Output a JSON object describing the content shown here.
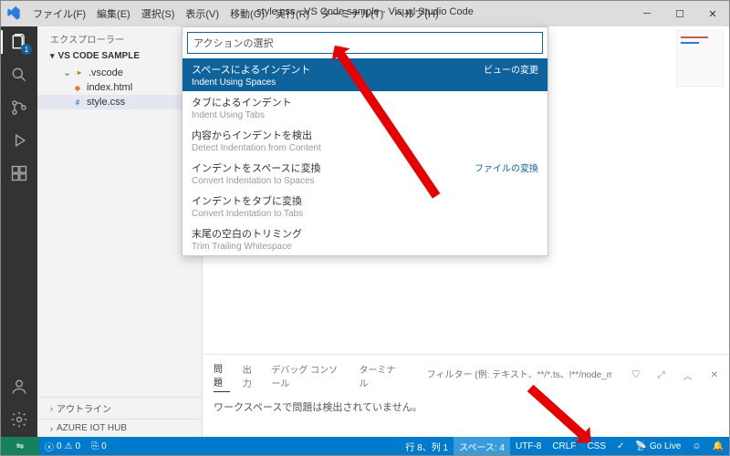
{
  "title": "style.css - VS Code sample - Visual Studio Code",
  "menu": [
    "ファイル(F)",
    "編集(E)",
    "選択(S)",
    "表示(V)",
    "移動(G)",
    "実行(R)",
    "ターミナル(T)",
    "ヘルプ(H)"
  ],
  "activity_badge": "1",
  "sidebar": {
    "title": "エクスプローラー",
    "root": "VS CODE SAMPLE",
    "items": [
      {
        "label": ".vscode",
        "type": "folder"
      },
      {
        "label": "index.html",
        "type": "html"
      },
      {
        "label": "style.css",
        "type": "css"
      }
    ],
    "bottom": [
      "アウトライン",
      "AZURE IOT HUB"
    ]
  },
  "quickpick": {
    "placeholder": "アクションの選択",
    "badge_view": "ビューの変更",
    "badge_file": "ファイルの変換",
    "rows": [
      {
        "l1": "スペースによるインデント",
        "l2": "Indent Using Spaces",
        "badge": "view"
      },
      {
        "l1": "タブによるインデント",
        "l2": "Indent Using Tabs"
      },
      {
        "l1": "内容からインデントを検出",
        "l2": "Detect Indentation from Content"
      },
      {
        "l1": "インデントをスペースに変換",
        "l2": "Convert Indentation to Spaces",
        "badge": "file"
      },
      {
        "l1": "インデントをタブに変換",
        "l2": "Convert Indentation to Tabs"
      },
      {
        "l1": "末尾の空白のトリミング",
        "l2": "Trim Trailing Whitespace"
      }
    ]
  },
  "panel": {
    "tabs": [
      "問題",
      "出力",
      "デバッグ コンソール",
      "ターミナル"
    ],
    "filter_placeholder": "フィルター (例: テキスト、**/*.ts、!**/node_modules/**)",
    "message": "ワークスペースで問題は検出されていません。"
  },
  "status": {
    "errors": "0",
    "warnings": "0",
    "port": "0",
    "line": "行 8、列 1",
    "spaces": "スペース: 4",
    "encoding": "UTF-8",
    "eol": "CRLF",
    "lang": "CSS",
    "check": "✓",
    "golive": "Go Live",
    "feedback": "☺",
    "bell": "🔔"
  }
}
